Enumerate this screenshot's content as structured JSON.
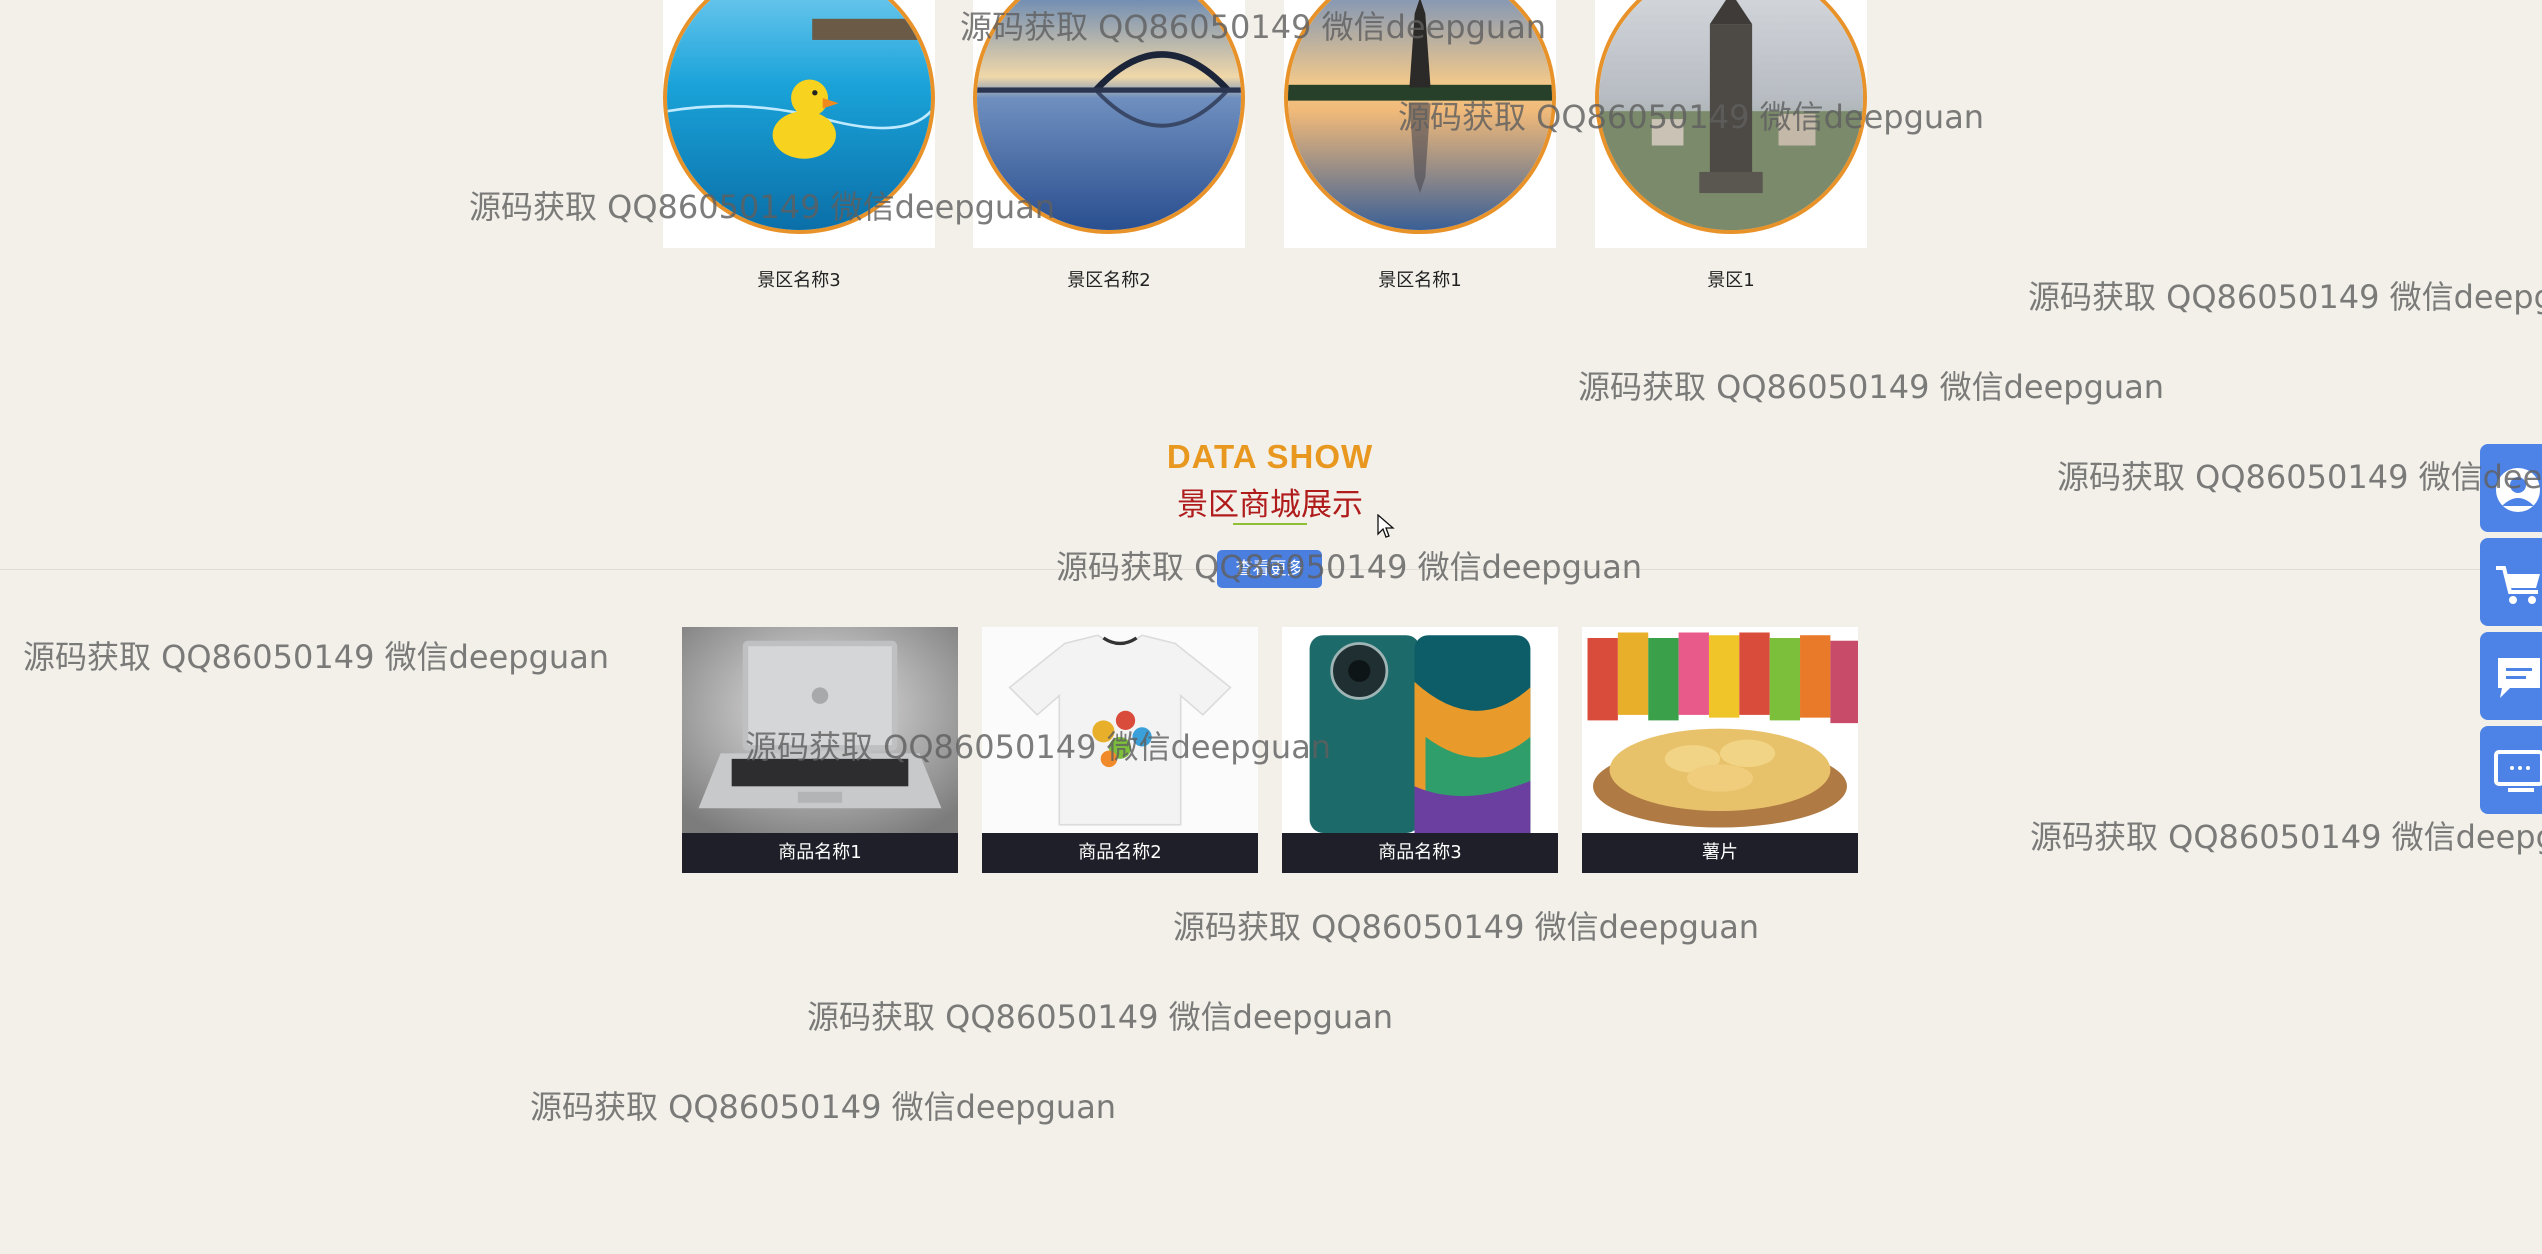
{
  "scenic": {
    "items": [
      {
        "label": "景区名称3",
        "image": "rubber-duck-pool-photo"
      },
      {
        "label": "景区名称2",
        "image": "bridge-sunset-photo"
      },
      {
        "label": "景区名称1",
        "image": "pagoda-lake-photo"
      },
      {
        "label": "景区1",
        "image": "monument-city-photo"
      }
    ]
  },
  "section": {
    "title_en": "DATA SHOW",
    "title_cn": "景区商城展示",
    "more_label": "查看更多"
  },
  "products": {
    "items": [
      {
        "label": "商品名称1",
        "image": "laptop-photo"
      },
      {
        "label": "商品名称2",
        "image": "tshirt-photo"
      },
      {
        "label": "商品名称3",
        "image": "phone-photo"
      },
      {
        "label": "薯片",
        "image": "chips-photo"
      }
    ]
  },
  "sidebar": {
    "items": [
      {
        "icon": "user-icon"
      },
      {
        "icon": "cart-icon"
      },
      {
        "icon": "message-icon"
      },
      {
        "icon": "monitor-icon"
      }
    ]
  },
  "watermark": {
    "text": "源码获取 QQ86050149 微信deepguan"
  },
  "colors": {
    "background": "#f3f0ea",
    "accent_orange": "#e8981f",
    "title_red": "#b01c1c",
    "button_blue": "#4a7fe0",
    "caption_dark": "#1e1f28"
  }
}
